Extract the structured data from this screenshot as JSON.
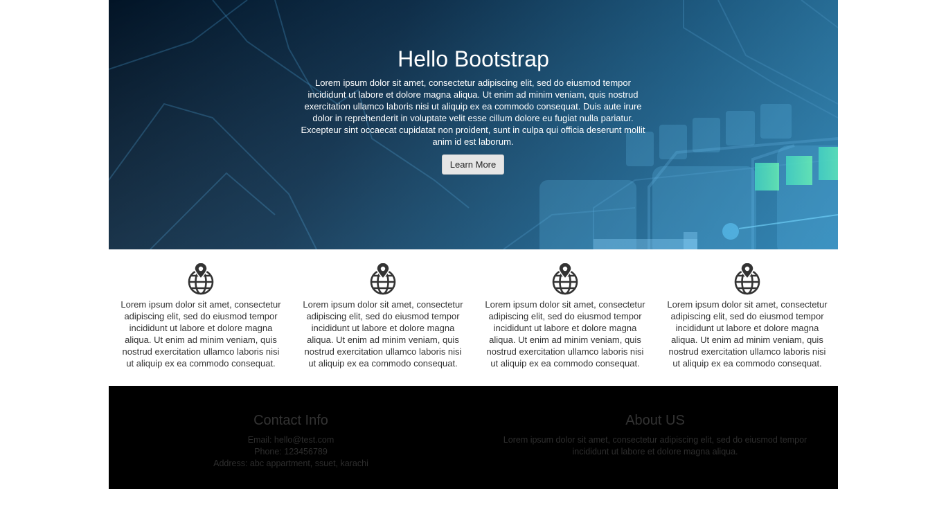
{
  "hero": {
    "title": "Hello Bootstrap",
    "text": "Lorem ipsum dolor sit amet, consectetur adipiscing elit, sed do eiusmod tempor incididunt ut labore et dolore magna aliqua. Ut enim ad minim veniam, quis nostrud exercitation ullamco laboris nisi ut aliquip ex ea commodo consequat. Duis aute irure dolor in reprehenderit in voluptate velit esse cillum dolore eu fugiat nulla pariatur. Excepteur sint occaecat cupidatat non proident, sunt in culpa qui officia deserunt mollit anim id est laborum.",
    "button_label": "Learn More"
  },
  "features": [
    {
      "icon": "globe-location-icon",
      "text": "Lorem ipsum dolor sit amet, consectetur adipiscing elit, sed do eiusmod tempor incididunt ut labore et dolore magna aliqua. Ut enim ad minim veniam, quis nostrud exercitation ullamco laboris nisi ut aliquip ex ea commodo consequat."
    },
    {
      "icon": "globe-location-icon",
      "text": "Lorem ipsum dolor sit amet, consectetur adipiscing elit, sed do eiusmod tempor incididunt ut labore et dolore magna aliqua. Ut enim ad minim veniam, quis nostrud exercitation ullamco laboris nisi ut aliquip ex ea commodo consequat."
    },
    {
      "icon": "globe-location-icon",
      "text": "Lorem ipsum dolor sit amet, consectetur adipiscing elit, sed do eiusmod tempor incididunt ut labore et dolore magna aliqua. Ut enim ad minim veniam, quis nostrud exercitation ullamco laboris nisi ut aliquip ex ea commodo consequat."
    },
    {
      "icon": "globe-location-icon",
      "text": "Lorem ipsum dolor sit amet, consectetur adipiscing elit, sed do eiusmod tempor incididunt ut labore et dolore magna aliqua. Ut enim ad minim veniam, quis nostrud exercitation ullamco laboris nisi ut aliquip ex ea commodo consequat."
    }
  ],
  "footer": {
    "contact": {
      "title": "Contact Info",
      "email": "Email: hello@test.com",
      "phone": "Phone: 123456789",
      "address": "Address: abc appartment, ssuet, karachi"
    },
    "about": {
      "title": "About US",
      "text": "Lorem ipsum dolor sit amet, consectetur adipiscing elit, sed do eiusmod tempor incididunt ut labore et dolore magna aliqua."
    }
  },
  "colors": {
    "hero_dark": "#021426",
    "hero_light": "#1a6f9e",
    "accent_green": "#3ef0a8",
    "footer_bg": "#000000"
  }
}
